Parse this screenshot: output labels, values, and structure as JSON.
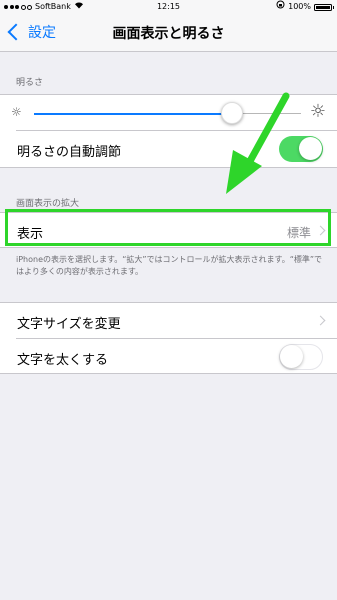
{
  "status_bar": {
    "carrier": "SoftBank",
    "time": "12:15",
    "battery": "100%"
  },
  "nav": {
    "back_label": "設定",
    "title": "画面表示と明るさ"
  },
  "brightness": {
    "header": "明るさ",
    "level": 0.74,
    "auto_label": "明るさの自動調節",
    "auto_on": true
  },
  "zoom": {
    "header": "画面表示の拡大",
    "view_label": "表示",
    "view_value": "標準",
    "footer": "iPhoneの表示を選択します。“拡大”ではコントロールが拡大表示されます。“標準”ではより多くの内容が表示されます。"
  },
  "text": {
    "size_label": "文字サイズを変更",
    "bold_label": "文字を太くする",
    "bold_on": false
  },
  "colors": {
    "accent": "#0a7aff",
    "toggle_on": "#4cd964",
    "annotation": "#2ed52a"
  }
}
